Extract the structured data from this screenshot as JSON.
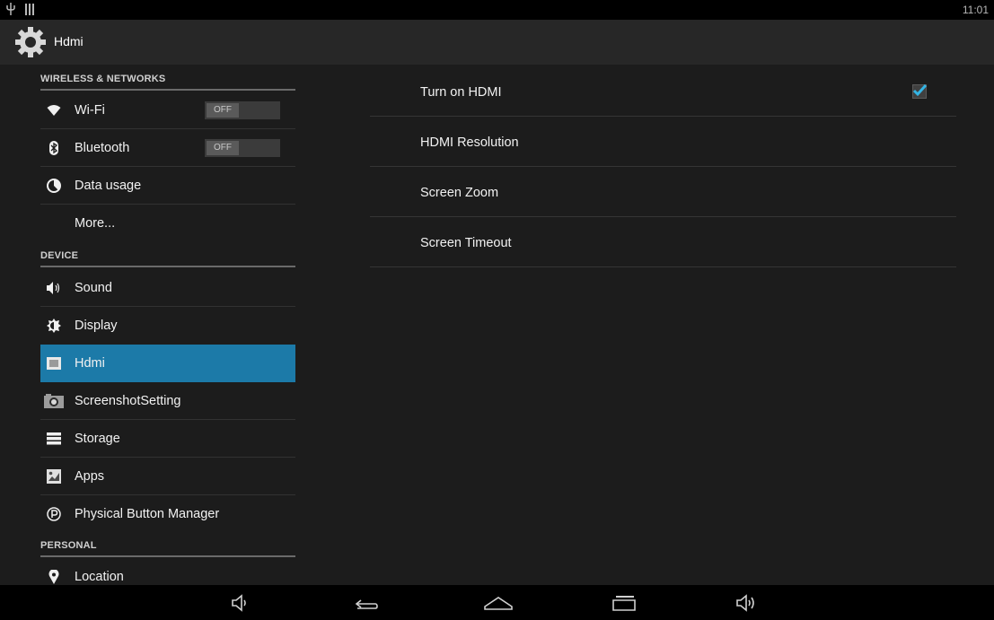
{
  "status_bar": {
    "time": "11:01",
    "icons": [
      "usb-icon",
      "sd-card-icon"
    ]
  },
  "action_bar": {
    "title": "Hdmi",
    "icon": "settings-gear-icon"
  },
  "sidebar": {
    "headers": {
      "wireless": "WIRELESS & NETWORKS",
      "device": "DEVICE",
      "personal": "PERSONAL"
    },
    "items": [
      {
        "label": "Wi-Fi",
        "icon": "wifi-icon",
        "toggle": "OFF"
      },
      {
        "label": "Bluetooth",
        "icon": "bluetooth-icon",
        "toggle": "OFF"
      },
      {
        "label": "Data usage",
        "icon": "data-usage-icon"
      },
      {
        "label": "More..."
      },
      {
        "label": "Sound",
        "icon": "sound-icon"
      },
      {
        "label": "Display",
        "icon": "display-icon"
      },
      {
        "label": "Hdmi",
        "icon": "hdmi-icon",
        "selected": true
      },
      {
        "label": "ScreenshotSetting",
        "icon": "camera-icon"
      },
      {
        "label": "Storage",
        "icon": "storage-icon"
      },
      {
        "label": "Apps",
        "icon": "apps-icon"
      },
      {
        "label": "Physical Button Manager",
        "icon": "physical-button-icon"
      },
      {
        "label": "Location",
        "icon": "location-pin-icon"
      }
    ]
  },
  "main": {
    "items": [
      {
        "label": "Turn on HDMI",
        "checked": true
      },
      {
        "label": "HDMI Resolution"
      },
      {
        "label": "Screen Zoom"
      },
      {
        "label": "Screen Timeout"
      }
    ]
  },
  "nav_bar": {
    "buttons": [
      "volume-down-icon",
      "back-icon",
      "home-icon",
      "recent-apps-icon",
      "volume-up-icon"
    ]
  },
  "colors": {
    "selected": "#1c7aa8",
    "checkmark": "#33b5e5",
    "background": "#1c1c1c"
  }
}
